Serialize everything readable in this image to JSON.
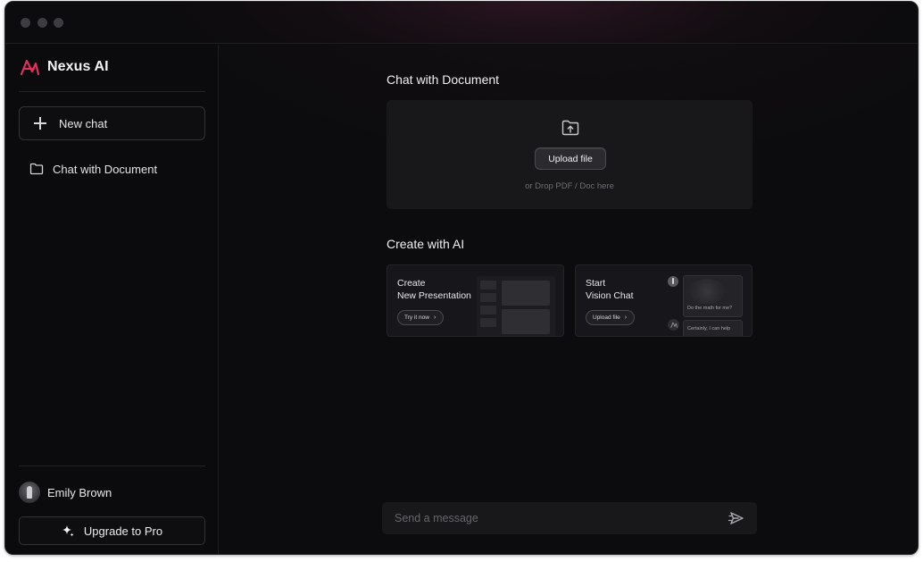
{
  "colors": {
    "accent": "#e0315c",
    "background": "#0c0b0d",
    "panel": "#18171a",
    "border": "#333236",
    "muted_text": "#6f6e73"
  },
  "sidebar": {
    "brand": {
      "name": "Nexus AI",
      "icon": "nexus-logo-icon"
    },
    "new_chat": {
      "label": "New chat",
      "icon": "plus-icon"
    },
    "items": [
      {
        "label": "Chat with Document",
        "icon": "folder-icon"
      }
    ],
    "user": {
      "name": "Emily Brown",
      "icon": "avatar"
    },
    "upgrade": {
      "label": "Upgrade to Pro",
      "icon": "sparkle-icon"
    }
  },
  "main": {
    "document_section": {
      "title": "Chat with Document",
      "upload_icon": "folder-upload-icon",
      "upload_button": "Upload file",
      "drop_hint": "or Drop PDF / Doc here"
    },
    "create_section": {
      "title": "Create with AI",
      "cards": [
        {
          "title_line1": "Create",
          "title_line2": "New Presentation",
          "action": "Try it now"
        },
        {
          "title_line1": "Start",
          "title_line2": "Vision Chat",
          "action": "Upload file",
          "preview_question": "Do the math for me?",
          "preview_answer": "Certainly, I can help"
        }
      ]
    },
    "composer": {
      "placeholder": "Send a message",
      "send_icon": "send-icon"
    }
  }
}
